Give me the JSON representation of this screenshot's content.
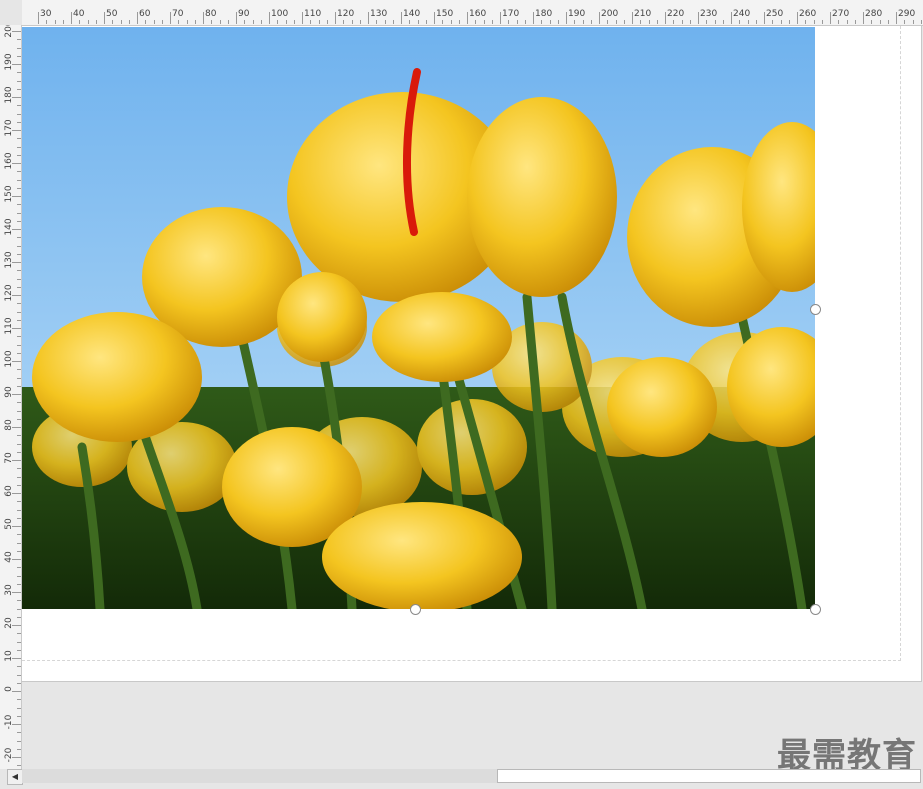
{
  "ruler": {
    "top_labels": [
      "30",
      "40",
      "50",
      "60",
      "70",
      "80",
      "90",
      "100",
      "110",
      "120",
      "130",
      "140",
      "150",
      "160",
      "170",
      "180",
      "190",
      "200",
      "210",
      "220",
      "230",
      "240",
      "250",
      "260",
      "270",
      "280",
      "290"
    ],
    "left_labels": [
      "200",
      "190",
      "180",
      "170",
      "160",
      "150",
      "140",
      "130",
      "120",
      "110",
      "100",
      "90",
      "80",
      "70",
      "60",
      "50",
      "40",
      "30",
      "20",
      "10",
      "0",
      "-10",
      "-20"
    ]
  },
  "photo": {
    "subject": "yellow-tulip-field",
    "sky_color": "#7db9ee",
    "petal_color": "#f2c21e",
    "stem_color": "#3e6a20"
  },
  "watermark": {
    "text": "最需教育"
  },
  "scrollbar": {
    "left_arrow": "◀"
  }
}
